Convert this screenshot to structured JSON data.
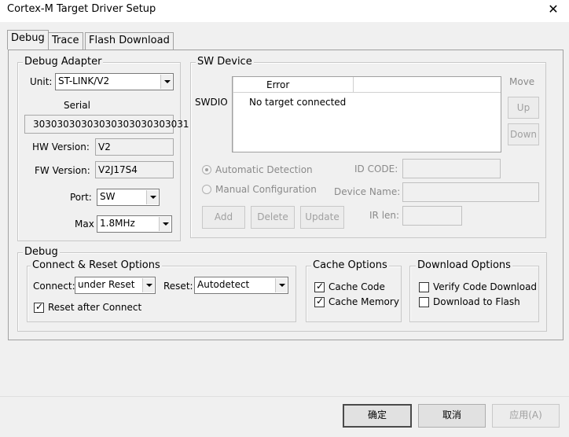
{
  "window": {
    "title": "Cortex-M Target Driver Setup",
    "close_glyph": "✕"
  },
  "tabs": [
    {
      "label": "Debug"
    },
    {
      "label": "Trace"
    },
    {
      "label": "Flash Download"
    }
  ],
  "debug_adapter": {
    "legend": "Debug Adapter",
    "unit_label": "Unit:",
    "unit_value": "ST-LINK/V2",
    "serial_label": "Serial",
    "serial_value": "30303030303030303030303031",
    "hw_label": "HW Version:",
    "hw_value": "V2",
    "fw_label": "FW Version:",
    "fw_value": "V2J17S4",
    "port_label": "Port:",
    "port_value": "SW",
    "max_label": "Max",
    "max_value": "1.8MHz"
  },
  "sw_device": {
    "legend": "SW Device",
    "swdio_label": "SWDIO",
    "column_header": "Error",
    "row_text": "No target connected",
    "move_label": "Move",
    "up_label": "Up",
    "down_label": "Down",
    "auto_detect_label": "Automatic Detection",
    "manual_config_label": "Manual Configuration",
    "id_code_label": "ID CODE:",
    "device_name_label": "Device Name:",
    "ir_len_label": "IR len:",
    "add_label": "Add",
    "delete_label": "Delete",
    "update_label": "Update"
  },
  "debug": {
    "legend": "Debug",
    "connect_reset": {
      "legend": "Connect & Reset Options",
      "connect_label": "Connect:",
      "connect_value": "under Reset",
      "reset_label": "Reset:",
      "reset_value": "Autodetect",
      "reset_after_connect_label": "Reset after Connect",
      "reset_after_connect_checked": true
    },
    "cache_options": {
      "legend": "Cache Options",
      "cache_code_label": "Cache Code",
      "cache_code_checked": true,
      "cache_memory_label": "Cache Memory",
      "cache_memory_checked": true
    },
    "download_options": {
      "legend": "Download Options",
      "verify_label": "Verify Code Download",
      "verify_checked": false,
      "download_flash_label": "Download to Flash",
      "download_flash_checked": false
    }
  },
  "footer": {
    "ok_label": "确定",
    "cancel_label": "取消",
    "apply_label": "应用(A)"
  }
}
